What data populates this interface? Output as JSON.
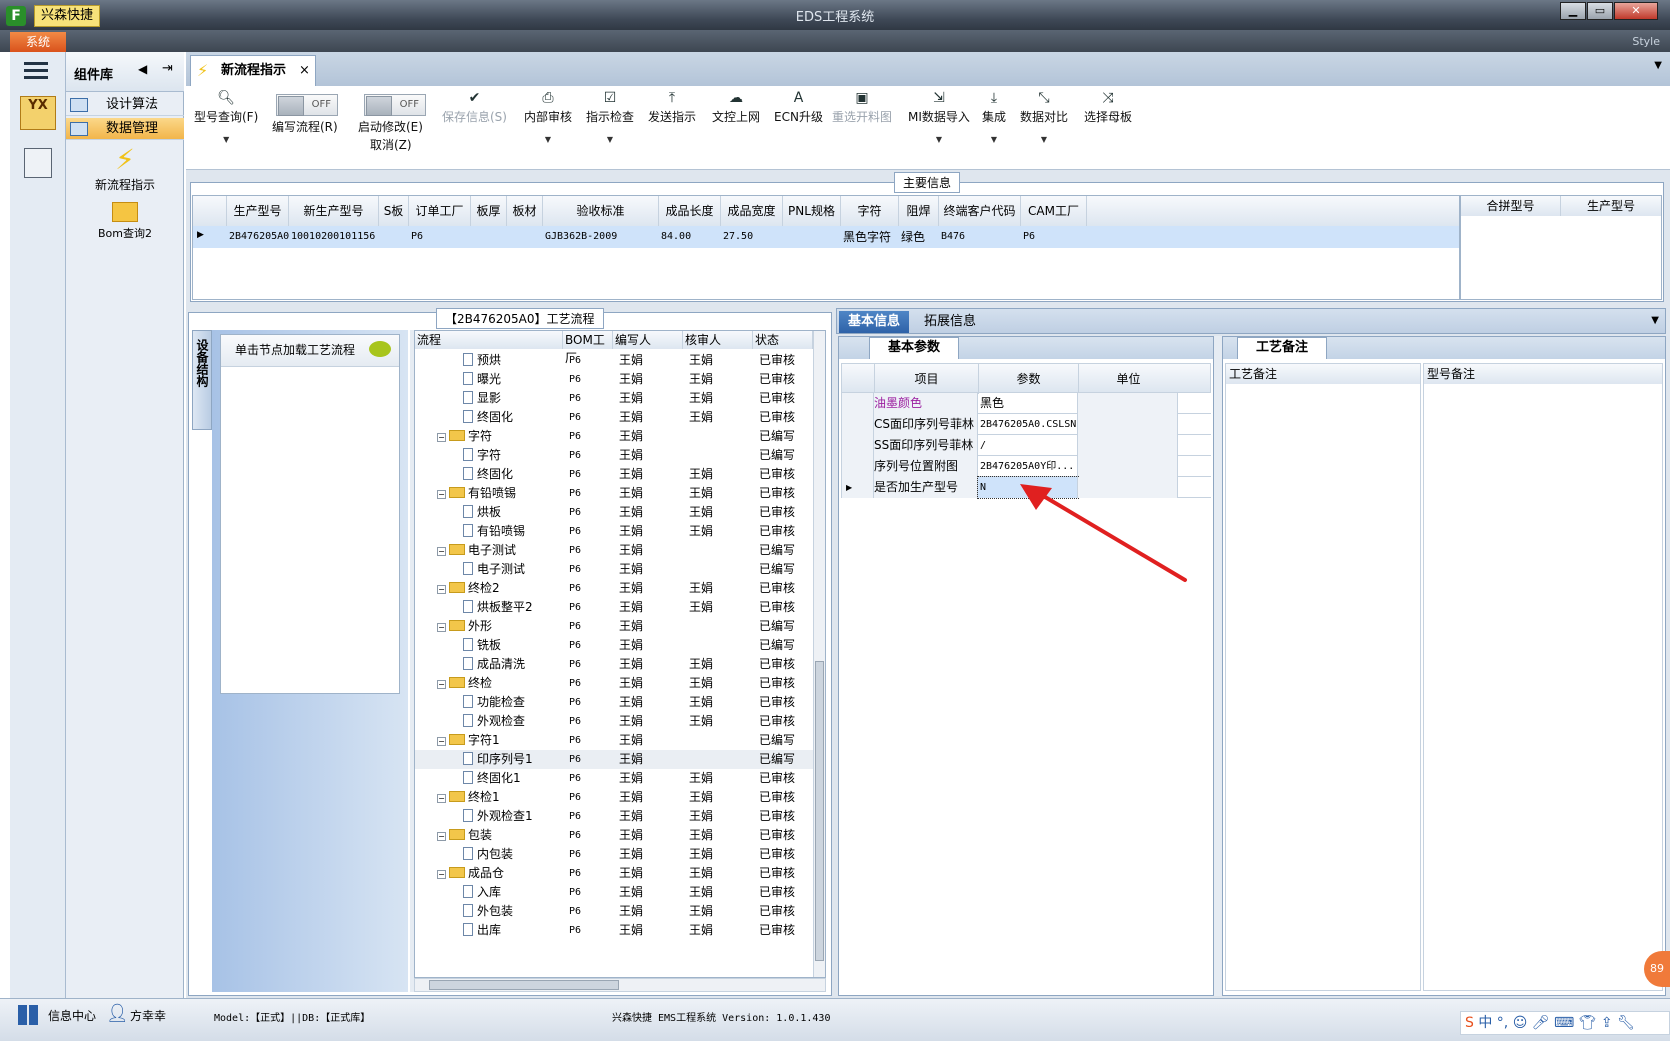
{
  "window": {
    "title": "EDS工程系统",
    "app_name": "兴森快捷",
    "sys_menu": "系统",
    "style": "Style"
  },
  "sidebar": {
    "brand": "YX",
    "components_title": "组件库",
    "items": [
      {
        "label": "设计算法"
      },
      {
        "label": "数据管理"
      }
    ],
    "shortcuts": [
      {
        "label": "新流程指示"
      },
      {
        "label": "Bom查询2"
      }
    ]
  },
  "tabs": [
    {
      "label": "新流程指示"
    }
  ],
  "toolbar": {
    "query": "型号查询(F)",
    "write_flow": "编写流程(R)",
    "start_modify": "启动修改(E)",
    "cancel": "取消(Z)",
    "toggle_off": "OFF",
    "save": "保存信息(S)",
    "internal_review": "内部审核",
    "check": "指示检查",
    "send": "发送指示",
    "upload": "文控上网",
    "ecn": "ECN升级",
    "reselect": "重选开料图",
    "mi_import": "MI数据导入",
    "integrate": "集成",
    "compare": "数据对比",
    "select_mother": "选择母板"
  },
  "main_info": {
    "title": "主要信息",
    "columns": [
      "生产型号",
      "新生产型号",
      "S板",
      "订单工厂",
      "板厚",
      "板材",
      "验收标准",
      "成品长度",
      "成品宽度",
      "PNL规格",
      "字符",
      "阻焊",
      "终端客户代码",
      "CAM工厂"
    ],
    "row": [
      "2B476205A0",
      "10010200101156",
      "",
      "P6",
      "",
      "",
      "GJB362B-2009",
      "84.00",
      "27.50",
      "",
      "黑色字符",
      "绿色",
      "B476",
      "P6"
    ],
    "side_columns": [
      "合拼型号",
      "生产型号"
    ]
  },
  "process": {
    "title": "【2B476205A0】工艺流程",
    "vertical_tab": "设备结构",
    "hint": "单击节点加载工艺流程",
    "columns": [
      "流程",
      "BOM工厂",
      "编写人",
      "核审人",
      "状态"
    ],
    "rows": [
      {
        "lvl": 2,
        "name": "预烘",
        "bom": "P6",
        "writer": "王娟",
        "reviewer": "王娟",
        "status": "已审核"
      },
      {
        "lvl": 2,
        "name": "曝光",
        "bom": "P6",
        "writer": "王娟",
        "reviewer": "王娟",
        "status": "已审核"
      },
      {
        "lvl": 2,
        "name": "显影",
        "bom": "P6",
        "writer": "王娟",
        "reviewer": "王娟",
        "status": "已审核"
      },
      {
        "lvl": 2,
        "name": "终固化",
        "bom": "P6",
        "writer": "王娟",
        "reviewer": "王娟",
        "status": "已审核"
      },
      {
        "lvl": 1,
        "name": "字符",
        "bom": "P6",
        "writer": "王娟",
        "reviewer": "",
        "status": "已编写"
      },
      {
        "lvl": 2,
        "name": "字符",
        "bom": "P6",
        "writer": "王娟",
        "reviewer": "",
        "status": "已编写"
      },
      {
        "lvl": 2,
        "name": "终固化",
        "bom": "P6",
        "writer": "王娟",
        "reviewer": "王娟",
        "status": "已审核"
      },
      {
        "lvl": 1,
        "name": "有铅喷锡",
        "bom": "P6",
        "writer": "王娟",
        "reviewer": "王娟",
        "status": "已审核"
      },
      {
        "lvl": 2,
        "name": "烘板",
        "bom": "P6",
        "writer": "王娟",
        "reviewer": "王娟",
        "status": "已审核"
      },
      {
        "lvl": 2,
        "name": "有铅喷锡",
        "bom": "P6",
        "writer": "王娟",
        "reviewer": "王娟",
        "status": "已审核"
      },
      {
        "lvl": 1,
        "name": "电子测试",
        "bom": "P6",
        "writer": "王娟",
        "reviewer": "",
        "status": "已编写"
      },
      {
        "lvl": 2,
        "name": "电子测试",
        "bom": "P6",
        "writer": "王娟",
        "reviewer": "",
        "status": "已编写"
      },
      {
        "lvl": 1,
        "name": "终检2",
        "bom": "P6",
        "writer": "王娟",
        "reviewer": "王娟",
        "status": "已审核"
      },
      {
        "lvl": 2,
        "name": "烘板整平2",
        "bom": "P6",
        "writer": "王娟",
        "reviewer": "王娟",
        "status": "已审核"
      },
      {
        "lvl": 1,
        "name": "外形",
        "bom": "P6",
        "writer": "王娟",
        "reviewer": "",
        "status": "已编写"
      },
      {
        "lvl": 2,
        "name": "铣板",
        "bom": "P6",
        "writer": "王娟",
        "reviewer": "",
        "status": "已编写"
      },
      {
        "lvl": 2,
        "name": "成品清洗",
        "bom": "P6",
        "writer": "王娟",
        "reviewer": "王娟",
        "status": "已审核"
      },
      {
        "lvl": 1,
        "name": "终检",
        "bom": "P6",
        "writer": "王娟",
        "reviewer": "王娟",
        "status": "已审核"
      },
      {
        "lvl": 2,
        "name": "功能检查",
        "bom": "P6",
        "writer": "王娟",
        "reviewer": "王娟",
        "status": "已审核"
      },
      {
        "lvl": 2,
        "name": "外观检查",
        "bom": "P6",
        "writer": "王娟",
        "reviewer": "王娟",
        "status": "已审核"
      },
      {
        "lvl": 1,
        "name": "字符1",
        "bom": "P6",
        "writer": "王娟",
        "reviewer": "",
        "status": "已编写"
      },
      {
        "lvl": 2,
        "name": "印序列号1",
        "bom": "P6",
        "writer": "王娟",
        "reviewer": "",
        "status": "已编写"
      },
      {
        "lvl": 2,
        "name": "终固化1",
        "bom": "P6",
        "writer": "王娟",
        "reviewer": "王娟",
        "status": "已审核"
      },
      {
        "lvl": 1,
        "name": "终检1",
        "bom": "P6",
        "writer": "王娟",
        "reviewer": "王娟",
        "status": "已审核"
      },
      {
        "lvl": 2,
        "name": "外观检查1",
        "bom": "P6",
        "writer": "王娟",
        "reviewer": "王娟",
        "status": "已审核"
      },
      {
        "lvl": 1,
        "name": "包装",
        "bom": "P6",
        "writer": "王娟",
        "reviewer": "王娟",
        "status": "已审核"
      },
      {
        "lvl": 2,
        "name": "内包装",
        "bom": "P6",
        "writer": "王娟",
        "reviewer": "王娟",
        "status": "已审核"
      },
      {
        "lvl": 1,
        "name": "成品仓",
        "bom": "P6",
        "writer": "王娟",
        "reviewer": "王娟",
        "status": "已审核"
      },
      {
        "lvl": 2,
        "name": "入库",
        "bom": "P6",
        "writer": "王娟",
        "reviewer": "王娟",
        "status": "已审核"
      },
      {
        "lvl": 2,
        "name": "外包装",
        "bom": "P6",
        "writer": "王娟",
        "reviewer": "王娟",
        "status": "已审核"
      },
      {
        "lvl": 2,
        "name": "出库",
        "bom": "P6",
        "writer": "王娟",
        "reviewer": "王娟",
        "status": "已审核"
      }
    ]
  },
  "basic": {
    "tabs": [
      "基本信息",
      "拓展信息"
    ],
    "sub_tab": "基本参数",
    "columns": [
      "项目",
      "参数",
      "单位"
    ],
    "rows": [
      {
        "item": "油墨颜色",
        "value": "黑色",
        "unit": ""
      },
      {
        "item": "CS面印序列号菲林",
        "value": "2B476205A0.CSLSN",
        "unit": ""
      },
      {
        "item": "SS面印序列号菲林",
        "value": "/",
        "unit": ""
      },
      {
        "item": "序列号位置附图",
        "value": "2B476205A0Y印...",
        "unit": ""
      },
      {
        "item": "是否加生产型号",
        "value": "N",
        "unit": ""
      }
    ]
  },
  "remarks": {
    "tab": "工艺备注",
    "columns": [
      "工艺备注",
      "型号备注"
    ]
  },
  "status": {
    "info_center": "信息中心",
    "user": "方幸幸",
    "model": "Model:【正式】||DB:【正式库】",
    "version": "兴森快捷 EMS工程系统 Version: 1.0.1.430",
    "badge": "89"
  },
  "colors": {
    "accent": "#f07a3a",
    "selected_row": "#cfe3fa",
    "highlight_item": "#9b1fa0",
    "arrow": "#e02020"
  }
}
